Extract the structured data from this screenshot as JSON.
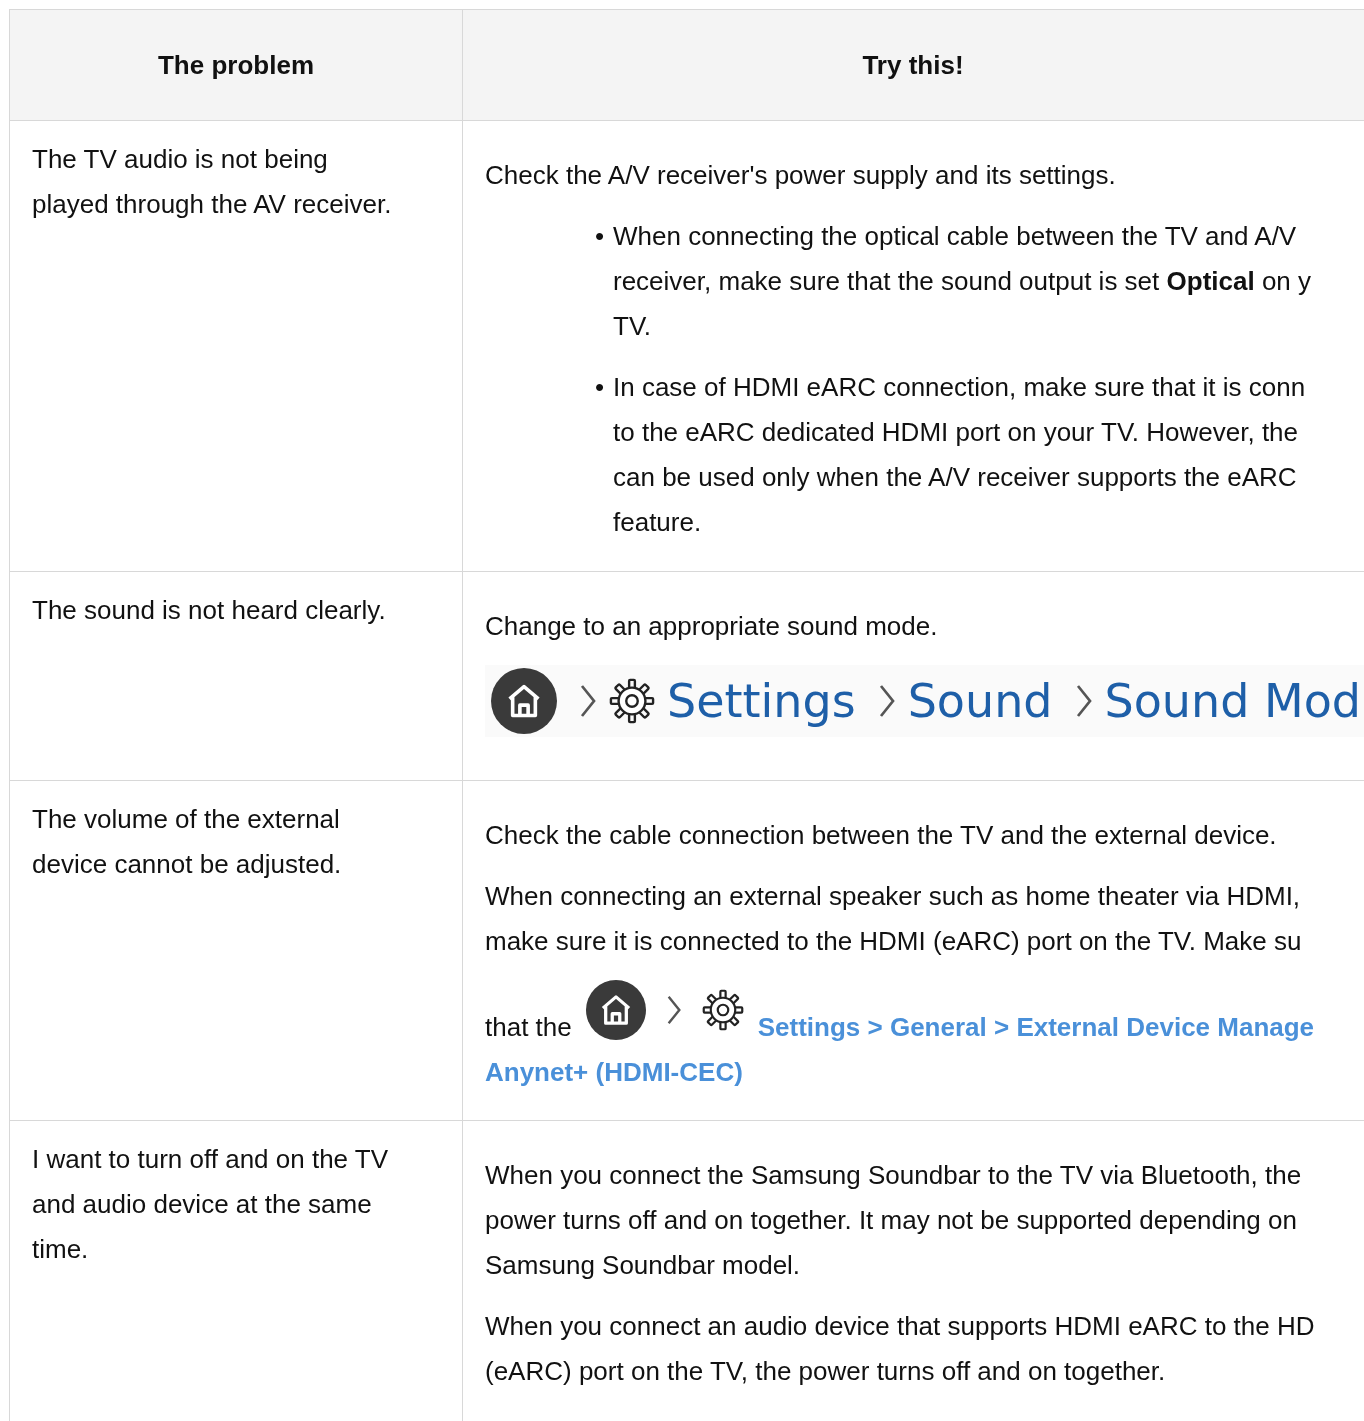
{
  "table": {
    "columns": [
      "The problem",
      "Try this!"
    ],
    "rows": [
      {
        "problem": [
          "The TV audio is not being",
          "played through the AV receiver."
        ],
        "solution": [
          {
            "kind": "paragraph",
            "lines": [
              "Check the A/V receiver's power supply and its settings."
            ]
          },
          {
            "kind": "bullet",
            "marker": "•",
            "lines": [
              "When connecting the optical cable between the TV and A/V",
              "receiver, make sure that the sound output is set **Optical** on y",
              "TV."
            ]
          },
          {
            "kind": "bullet",
            "marker": "•",
            "lines": [
              "In case of HDMI eARC connection, make sure that it is conn",
              "to the eARC dedicated HDMI port on your TV. However, the",
              "can be used only when the A/V receiver supports the eARC",
              "feature."
            ]
          }
        ]
      },
      {
        "problem": [
          "The sound is not heard clearly."
        ],
        "solution": [
          {
            "kind": "paragraph",
            "lines": [
              "Change to an appropriate sound mode."
            ]
          },
          {
            "kind": "menu_path",
            "steps": [
              "Settings",
              "Sound",
              "Sound Mod"
            ]
          }
        ]
      },
      {
        "problem": [
          "The volume of the external",
          "device cannot be adjusted."
        ],
        "solution": [
          {
            "kind": "paragraph",
            "lines": [
              "Check the cable connection between the TV and the external device."
            ]
          },
          {
            "kind": "paragraph",
            "lines": [
              "When connecting an external speaker such as home theater via HDMI,",
              "make sure it is connected to the HDMI (eARC) port on the TV. Make su"
            ]
          },
          {
            "kind": "inline_path",
            "lead": "that the",
            "path": "Settings > General > External Device Manage",
            "continuation": "Anynet+ (HDMI-CEC)"
          }
        ]
      },
      {
        "problem": [
          "I want to turn off and on the TV",
          "and audio device at the same",
          "time."
        ],
        "solution": [
          {
            "kind": "paragraph",
            "lines": [
              "When you connect the Samsung Soundbar to the TV via Bluetooth, the",
              "power turns off and on together. It may not be supported depending on",
              "Samsung Soundbar model."
            ]
          },
          {
            "kind": "paragraph",
            "lines": [
              "When you connect an audio device that supports HDMI eARC to the HD",
              "(eARC) port on the TV, the power turns off and on together."
            ]
          }
        ]
      }
    ]
  }
}
